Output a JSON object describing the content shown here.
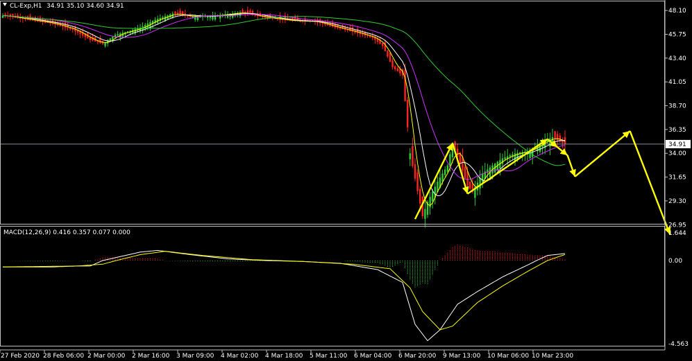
{
  "chart_data": [
    {
      "type": "candlestick",
      "symbol_label": "CL-Exp,H1",
      "ohlc_label": "34.91 35.10 34.60 34.91",
      "ylim": [
        26.9,
        49.0
      ],
      "price_ticks": [
        "48.10",
        "45.75",
        "43.40",
        "41.05",
        "38.70",
        "36.35",
        "34.00",
        "31.65",
        "29.30",
        "26.95"
      ],
      "current_price": "34.91",
      "time_ticks": [
        "27 Feb 2020",
        "28 Feb 06:00",
        "2 Mar 00:00",
        "2 Mar 16:00",
        "3 Mar 09:00",
        "4 Mar 02:00",
        "4 Mar 18:00",
        "5 Mar 11:00",
        "6 Mar 04:00",
        "6 Mar 20:00",
        "9 Mar 13:00",
        "10 Mar 06:00",
        "10 Mar 23:00"
      ],
      "close_keypoints": [
        [
          0,
          47.6
        ],
        [
          10,
          47.2
        ],
        [
          20,
          46.8
        ],
        [
          28,
          46.2
        ],
        [
          35,
          45.2
        ],
        [
          40,
          44.8
        ],
        [
          45,
          45.7
        ],
        [
          55,
          46.4
        ],
        [
          60,
          47.1
        ],
        [
          68,
          47.8
        ],
        [
          75,
          47.5
        ],
        [
          85,
          47.6
        ],
        [
          95,
          47.9
        ],
        [
          105,
          47.4
        ],
        [
          115,
          47.1
        ],
        [
          125,
          47.0
        ],
        [
          132,
          46.5
        ],
        [
          140,
          46.0
        ],
        [
          148,
          45.4
        ],
        [
          152,
          44.6
        ],
        [
          156,
          42.5
        ],
        [
          160,
          41.7
        ],
        [
          163,
          34.0
        ],
        [
          165,
          31.5
        ],
        [
          168,
          27.8
        ],
        [
          170,
          29.2
        ],
        [
          174,
          31.2
        ],
        [
          178,
          32.8
        ],
        [
          180,
          35.0
        ],
        [
          183,
          33.0
        ],
        [
          186,
          30.8
        ],
        [
          188,
          30.2
        ],
        [
          192,
          32.0
        ],
        [
          196,
          32.8
        ],
        [
          200,
          33.5
        ],
        [
          205,
          34.0
        ],
        [
          210,
          34.2
        ],
        [
          215,
          35.0
        ],
        [
          220,
          35.6
        ],
        [
          222,
          35.3
        ],
        [
          225,
          34.91
        ]
      ],
      "moving_averages": [
        {
          "color": "#FFFF00",
          "period": "fast"
        },
        {
          "color": "#FFFFFF",
          "period": "medium"
        },
        {
          "color": "#CC33FF",
          "period": "slow"
        },
        {
          "color": "#33CC33",
          "period": "long"
        }
      ],
      "projection_path": [
        [
          165,
          27.5
        ],
        [
          180,
          35.0
        ],
        [
          186,
          30.0
        ],
        [
          218,
          35.4
        ],
        [
          222,
          34.6
        ],
        [
          226,
          33.8
        ],
        [
          229,
          31.7
        ],
        [
          251,
          36.2
        ],
        [
          267,
          26.0
        ]
      ],
      "colors": {
        "bull": "#33CC33",
        "bear": "#FF2222",
        "arrow": "#FFFF00",
        "grid": "#808080"
      }
    },
    {
      "type": "macd",
      "label": "MACD(12,26,9) 0.416 0.357 0.077 0.000",
      "ylim": [
        -4.563,
        1.644
      ],
      "ticks": [
        "1.644",
        "0.00",
        "-4.563"
      ],
      "macd_keypoints": [
        [
          0,
          -0.35
        ],
        [
          20,
          -0.35
        ],
        [
          30,
          -0.3
        ],
        [
          35,
          -0.3
        ],
        [
          40,
          0.0
        ],
        [
          55,
          0.5
        ],
        [
          62,
          0.6
        ],
        [
          75,
          0.35
        ],
        [
          90,
          0.1
        ],
        [
          105,
          0.0
        ],
        [
          120,
          -0.05
        ],
        [
          135,
          -0.15
        ],
        [
          150,
          -0.5
        ],
        [
          160,
          -1.2
        ],
        [
          165,
          -3.5
        ],
        [
          170,
          -4.4
        ],
        [
          175,
          -3.8
        ],
        [
          182,
          -2.4
        ],
        [
          190,
          -1.7
        ],
        [
          200,
          -0.9
        ],
        [
          210,
          -0.25
        ],
        [
          218,
          0.3
        ],
        [
          225,
          0.416
        ]
      ],
      "signal_keypoints": [
        [
          0,
          -0.35
        ],
        [
          30,
          -0.3
        ],
        [
          40,
          -0.2
        ],
        [
          55,
          0.35
        ],
        [
          65,
          0.55
        ],
        [
          80,
          0.3
        ],
        [
          100,
          0.05
        ],
        [
          120,
          -0.05
        ],
        [
          140,
          -0.2
        ],
        [
          155,
          -0.45
        ],
        [
          163,
          -1.5
        ],
        [
          168,
          -2.8
        ],
        [
          175,
          -3.8
        ],
        [
          180,
          -3.6
        ],
        [
          190,
          -2.3
        ],
        [
          200,
          -1.4
        ],
        [
          210,
          -0.6
        ],
        [
          218,
          0.0
        ],
        [
          225,
          0.357
        ]
      ],
      "colors": {
        "macd": "#FFFFFF",
        "signal": "#FFFF00",
        "hist_pos": "#FF2222",
        "hist_neg": "#33CC33"
      }
    }
  ]
}
